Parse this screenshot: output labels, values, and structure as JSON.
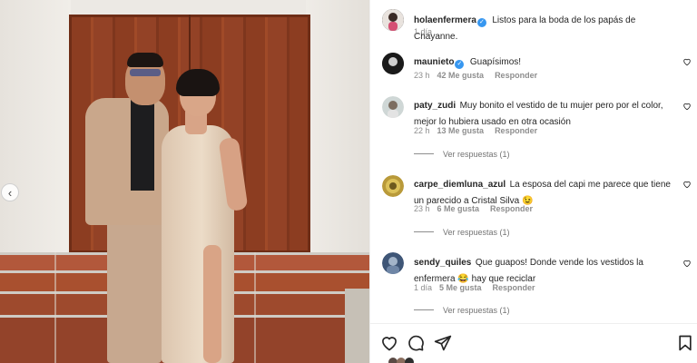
{
  "post": {
    "author": "holaenfermera",
    "caption": "Listos para la boda de los papás de Chayanne.",
    "time": "1 día"
  },
  "comments": [
    {
      "username": "maunieto",
      "verified": true,
      "text": "Guapísimos!",
      "time": "23 h",
      "likes": "42 Me gusta",
      "reply": "Responder"
    },
    {
      "username": "paty_zudi",
      "verified": false,
      "text": "Muy bonito el vestido de tu mujer pero por el color, mejor lo hubiera usado en otra ocasión",
      "time": "22 h",
      "likes": "13 Me gusta",
      "reply": "Responder",
      "view_replies": "Ver respuestas (1)"
    },
    {
      "username": "carpe_diemluna_azul",
      "verified": false,
      "text": "La esposa del capi me parece que tiene un parecido a Cristal Silva 😉",
      "time": "23 h",
      "likes": "6 Me gusta",
      "reply": "Responder",
      "view_replies": "Ver respuestas (1)"
    },
    {
      "username": "sendy_quiles",
      "verified": false,
      "text": "Que guapos! Donde vende los vestidos la enfermera 😂 hay que reciclar",
      "time": "1 día",
      "likes": "5 Me gusta",
      "reply": "Responder",
      "view_replies": "Ver respuestas (1)"
    }
  ],
  "icons": {
    "like": "heart-icon",
    "comment": "comment-icon",
    "share": "share-icon",
    "save": "bookmark-icon",
    "prev": "chevron-left-icon"
  },
  "colors": {
    "verified": "#3797f0",
    "text": "#262626",
    "muted": "#8e8e8e"
  }
}
